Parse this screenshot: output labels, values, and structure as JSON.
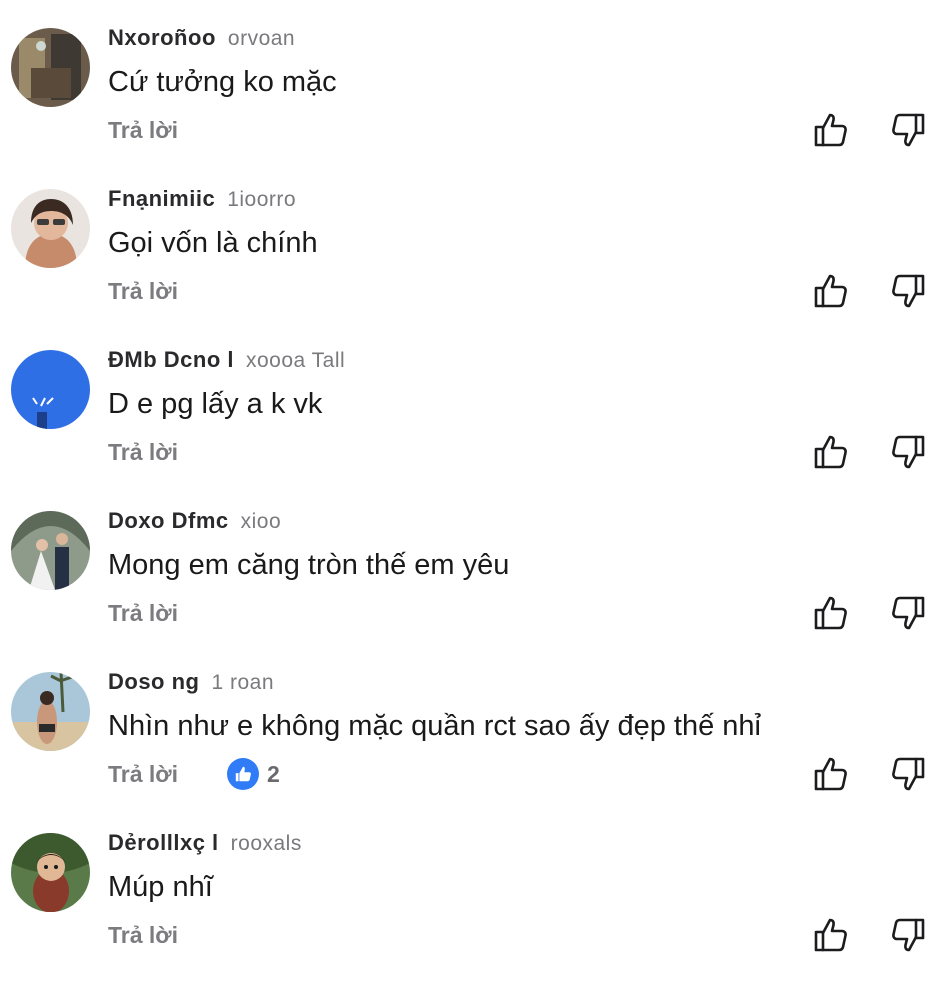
{
  "comments": [
    {
      "author": "Nxoroñoo",
      "time": "orvoan",
      "text": "Cứ tưởng ko mặc",
      "reply": "Trả lời",
      "avatar_color": "#6b5b4a"
    },
    {
      "author": "Fnạnimiic",
      "time": "1ioorro",
      "text": "Gọi vốn là chính",
      "reply": "Trả lời",
      "avatar_color": "#d8cfc8"
    },
    {
      "author": "ĐMb Dcno l",
      "time": "xoooa  Tall",
      "text": "D e pg lấy a k vk",
      "reply": "Trả lời",
      "avatar_color": "#2f6fe6"
    },
    {
      "author": "Doxo Dfmc",
      "time": "xioo",
      "text": "Mong em căng tròn thế em yêu",
      "reply": "Trả lời",
      "avatar_color": "#7a8a7a"
    },
    {
      "author": "Doso  ng",
      "time": "1 roan",
      "text": "Nhìn như e không mặc quần rct sao ấy đẹp thế nhỉ",
      "reply": "Trả lời",
      "reaction_count": "2",
      "avatar_color": "#8fb3c9"
    },
    {
      "author": "Dẻrolllxç l",
      "time": "rooxals",
      "text": "Múp nhĩ",
      "reply": "Trả lời",
      "avatar_color": "#4a6a3a"
    }
  ],
  "colors": {
    "reaction_blue": "#2f7cf6",
    "muted": "#7b7b80"
  },
  "icons": [
    "thumbs-up-icon",
    "thumbs-down-icon",
    "like-reaction-icon"
  ]
}
